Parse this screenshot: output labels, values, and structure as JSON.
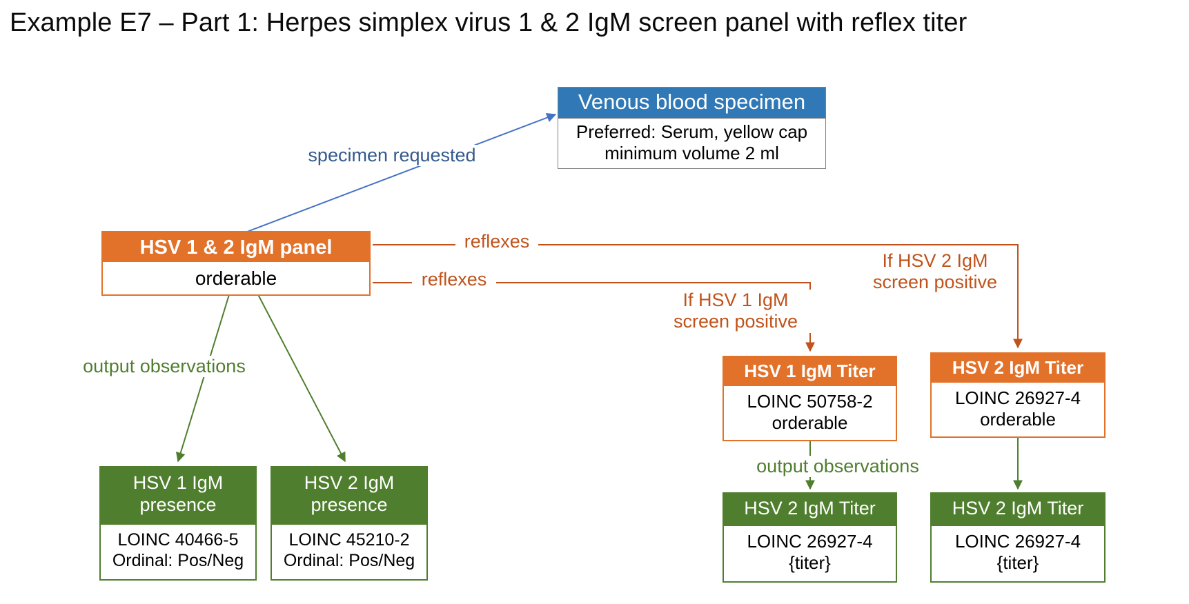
{
  "title": "Example E7 – Part 1: Herpes simplex virus 1 & 2 IgM screen panel  with reflex titer",
  "colors": {
    "blue": "#3079B6",
    "orange": "#E2712A",
    "green": "#4F7E2E",
    "blue_label": "#33598E",
    "orange_label": "#C0531B",
    "green_label": "#4F7E2E",
    "background": "#FFFFFF"
  },
  "nodes": {
    "specimen": {
      "header": "Venous blood specimen",
      "body": "Preferred: Serum, yellow cap\nminimum volume 2 ml",
      "color": "blue"
    },
    "panel": {
      "header": "HSV 1 & 2 IgM panel",
      "body": "orderable",
      "color": "orange"
    },
    "hsv1_titer": {
      "header": "HSV 1 IgM Titer",
      "body": "LOINC 50758-2\norderable",
      "color": "orange"
    },
    "hsv2_titer": {
      "header": "HSV 2 IgM Titer",
      "body": "LOINC 26927-4\norderable",
      "color": "orange"
    },
    "hsv1_presence": {
      "header": "HSV 1 IgM\npresence",
      "body": "LOINC 40466-5\nOrdinal: Pos/Neg",
      "color": "green"
    },
    "hsv2_presence": {
      "header": "HSV 2 IgM\npresence",
      "body": "LOINC 45210-2\nOrdinal: Pos/Neg",
      "color": "green"
    },
    "titer_output_left": {
      "header": "HSV 2 IgM Titer",
      "body": "LOINC 26927-4\n{titer}",
      "color": "green"
    },
    "titer_output_right": {
      "header": "HSV 2 IgM Titer",
      "body": "LOINC 26927-4\n{titer}",
      "color": "green"
    }
  },
  "edge_labels": {
    "specimen_requested": "specimen requested",
    "reflexes_upper": "reflexes",
    "reflexes_lower": "reflexes",
    "if_hsv1_positive": "If HSV 1 IgM\nscreen positive",
    "if_hsv2_positive": "If HSV 2 IgM\nscreen positive",
    "output_observations_left": "output observations",
    "output_observations_right": "output observations"
  }
}
